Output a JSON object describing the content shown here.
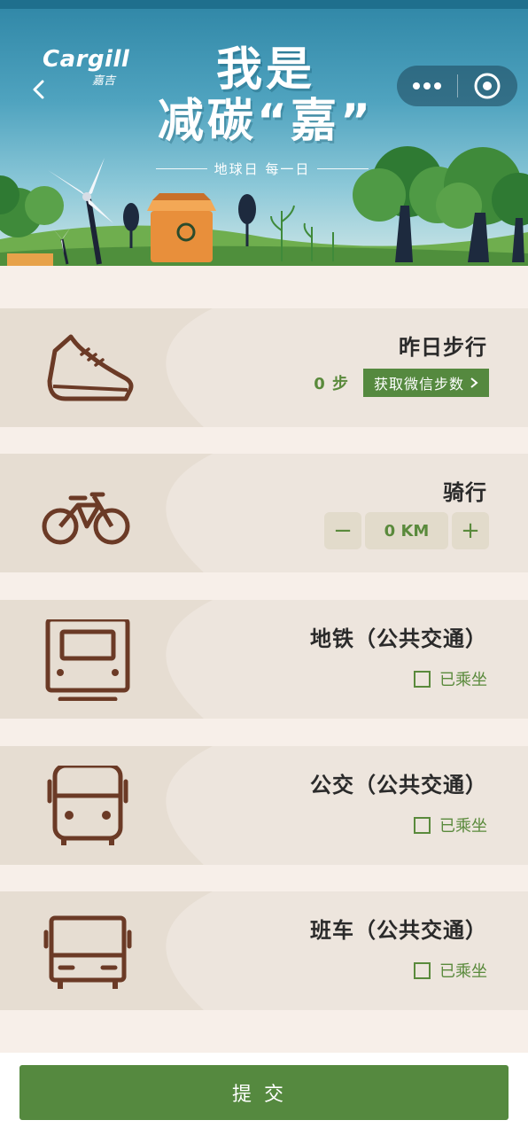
{
  "banner": {
    "brand_name": "Cargill",
    "brand_sub": "嘉吉",
    "headline_line1": "我是",
    "headline_line2": "减碳“嘉”",
    "tagline": "地球日  每一日"
  },
  "activities": [
    {
      "title": "昨日步行",
      "icon": "sneaker-icon",
      "steps": "0 步",
      "action_label": "获取微信步数"
    },
    {
      "title": "骑行",
      "icon": "bicycle-icon",
      "distance": "0 KM",
      "minus": "−",
      "plus": "+"
    },
    {
      "title": "地铁（公共交通）",
      "icon": "subway-icon",
      "check_label": "已乘坐"
    },
    {
      "title": "公交（公共交通）",
      "icon": "bus-icon",
      "check_label": "已乘坐"
    },
    {
      "title": "班车（公共交通）",
      "icon": "shuttle-bus-icon",
      "check_label": "已乘坐"
    }
  ],
  "footer": {
    "submit_label": "提交"
  },
  "colors": {
    "accent": "#55893f",
    "icon_brown": "#6b3a26",
    "card_bg": "#ede5dd",
    "page_bg": "#f7efe9"
  }
}
